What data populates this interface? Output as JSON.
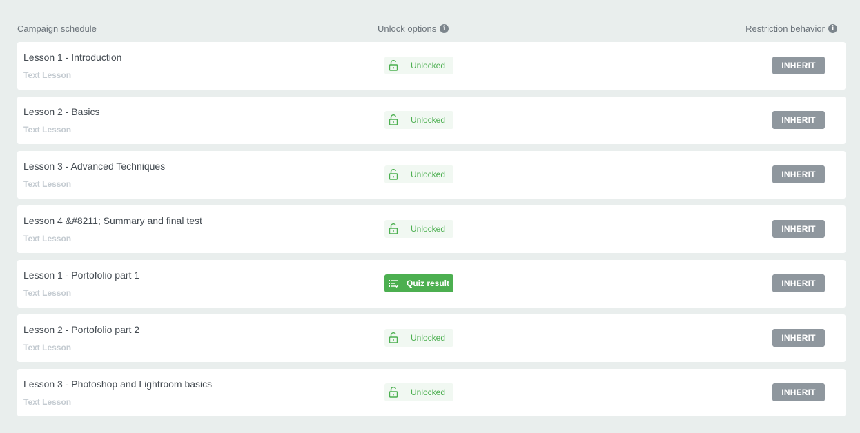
{
  "header": {
    "campaign_schedule": "Campaign schedule",
    "unlock_options": "Unlock options",
    "restriction_behavior": "Restriction behavior",
    "info_glyph": "i"
  },
  "colors": {
    "background": "#e9eeed",
    "accent_green": "#4caf50",
    "inherit_button": "#8f979e"
  },
  "lessons": [
    {
      "title": "Lesson 1 - Introduction",
      "type": "Text Lesson",
      "unlock": {
        "kind": "unlocked",
        "label": "Unlocked",
        "icon": "unlock-icon"
      },
      "restriction": "INHERIT"
    },
    {
      "title": "Lesson 2 - Basics",
      "type": "Text Lesson",
      "unlock": {
        "kind": "unlocked",
        "label": "Unlocked",
        "icon": "unlock-icon"
      },
      "restriction": "INHERIT"
    },
    {
      "title": "Lesson 3 - Advanced Techniques",
      "type": "Text Lesson",
      "unlock": {
        "kind": "unlocked",
        "label": "Unlocked",
        "icon": "unlock-icon"
      },
      "restriction": "INHERIT"
    },
    {
      "title": "Lesson 4 &#8211; Summary and final test",
      "type": "Text Lesson",
      "unlock": {
        "kind": "unlocked",
        "label": "Unlocked",
        "icon": "unlock-icon"
      },
      "restriction": "INHERIT"
    },
    {
      "title": "Lesson 1 - Portofolio part 1",
      "type": "Text Lesson",
      "unlock": {
        "kind": "quiz",
        "label": "Quiz result",
        "icon": "quiz-list-icon"
      },
      "restriction": "INHERIT"
    },
    {
      "title": "Lesson 2 - Portofolio part 2",
      "type": "Text Lesson",
      "unlock": {
        "kind": "unlocked",
        "label": "Unlocked",
        "icon": "unlock-icon"
      },
      "restriction": "INHERIT"
    },
    {
      "title": "Lesson 3 - Photoshop and Lightroom basics",
      "type": "Text Lesson",
      "unlock": {
        "kind": "unlocked",
        "label": "Unlocked",
        "icon": "unlock-icon"
      },
      "restriction": "INHERIT"
    }
  ]
}
